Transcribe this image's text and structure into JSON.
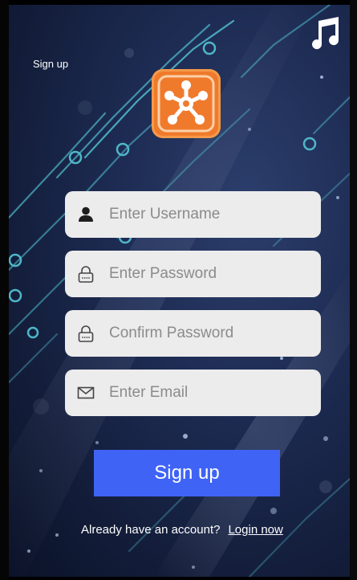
{
  "header": {
    "title": "Sign up",
    "music_icon": "music-note-icon"
  },
  "logo": {
    "icon": "network-hub-icon",
    "color": "#f07a2c"
  },
  "form": {
    "username_placeholder": "Enter Username",
    "password_placeholder": "Enter Password",
    "confirm_placeholder": "Confirm Password",
    "email_placeholder": "Enter Email",
    "submit_label": "Sign up"
  },
  "footer": {
    "prompt": "Already have an account?",
    "login_link": "Login now"
  },
  "colors": {
    "button": "#3f63f5",
    "background": "#1d2b52",
    "circuit": "#4fb6c8",
    "field": "#ececec"
  }
}
